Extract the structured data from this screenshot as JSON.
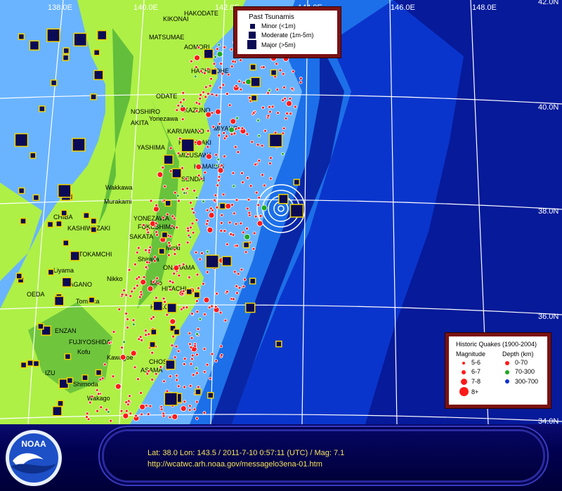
{
  "map": {
    "longitude_labels": [
      "138.0E",
      "140.0E",
      "142.0E",
      "144.0E",
      "146.0E",
      "148.0E"
    ],
    "latitude_labels": [
      "42.0N",
      "40.0N",
      "38.0N",
      "36.0N",
      "34.0N"
    ],
    "colors": {
      "land": "#aef046",
      "land_green": "#2f9c33",
      "shallow_sea": "#6ab4ff",
      "mid_sea": "#1c6fe8",
      "deep_sea": "#0a35cc",
      "trench": "#061a9a",
      "grid": "#ffffff",
      "tsunami_square": "#0b0b55",
      "tsunami_border": "#f2d300",
      "quake_red": "#ff1a1a",
      "quake_green": "#1fa81f"
    },
    "place_labels": [
      "KIKONAI",
      "HAKODATE",
      "MATSUMAE",
      "AOMORI",
      "HACHINOHE",
      "ODATE",
      "NOSHIRO",
      "KAZUNO",
      "Yonezawa",
      "AKITA",
      "KARUWANO",
      "HANAMAKI",
      "YASHIMA",
      "MIYAKO",
      "MIZUSAWA",
      "KAMAISHI",
      "SENDAI",
      "Murakami",
      "YONEZAWA",
      "FUKUSHIMA",
      "SAKATA",
      "ONAHAMA",
      "HOKOTA",
      "CHIBA",
      "TOKAMCHI",
      "KASHIWAZAKI",
      "Nikko",
      "NAGANO",
      "OEDA",
      "ENZAN",
      "FUJIYOSHIDA",
      "IZU",
      "CHOSHI",
      "Wakkawa",
      "Shiraka",
      "Mito",
      "HITACHI",
      "Liyama",
      "Tomioka",
      "Kofu",
      "ASAMA",
      "Kawagoe",
      "Shimoda",
      "Wakago",
      "Iwaki"
    ],
    "epicenter": {
      "lat": 38.0,
      "lon": 143.5
    }
  },
  "tsunami_legend": {
    "title": "Past Tsunamis",
    "items": [
      "Minor (<1m)",
      "Moderate (1m-5m)",
      "Major (>5m)"
    ]
  },
  "quake_legend": {
    "title": "Historic Quakes (1900-2004)",
    "magnitude_header": "Magnitude",
    "depth_header": "Depth (km)",
    "magnitudes": [
      "5-6",
      "6-7",
      "7-8",
      "8+"
    ],
    "depths": [
      "0-70",
      "70-300",
      "300-700"
    ]
  },
  "footer": {
    "logo_text": "NOAA",
    "info_line1": "Lat: 38.0  Lon: 143.5 / 2011-7-10  0:57:11 (UTC) / Mag: 7.1",
    "info_line2": "http://wcatwc.arh.noaa.gov/messagelo3ena-01.htm"
  }
}
